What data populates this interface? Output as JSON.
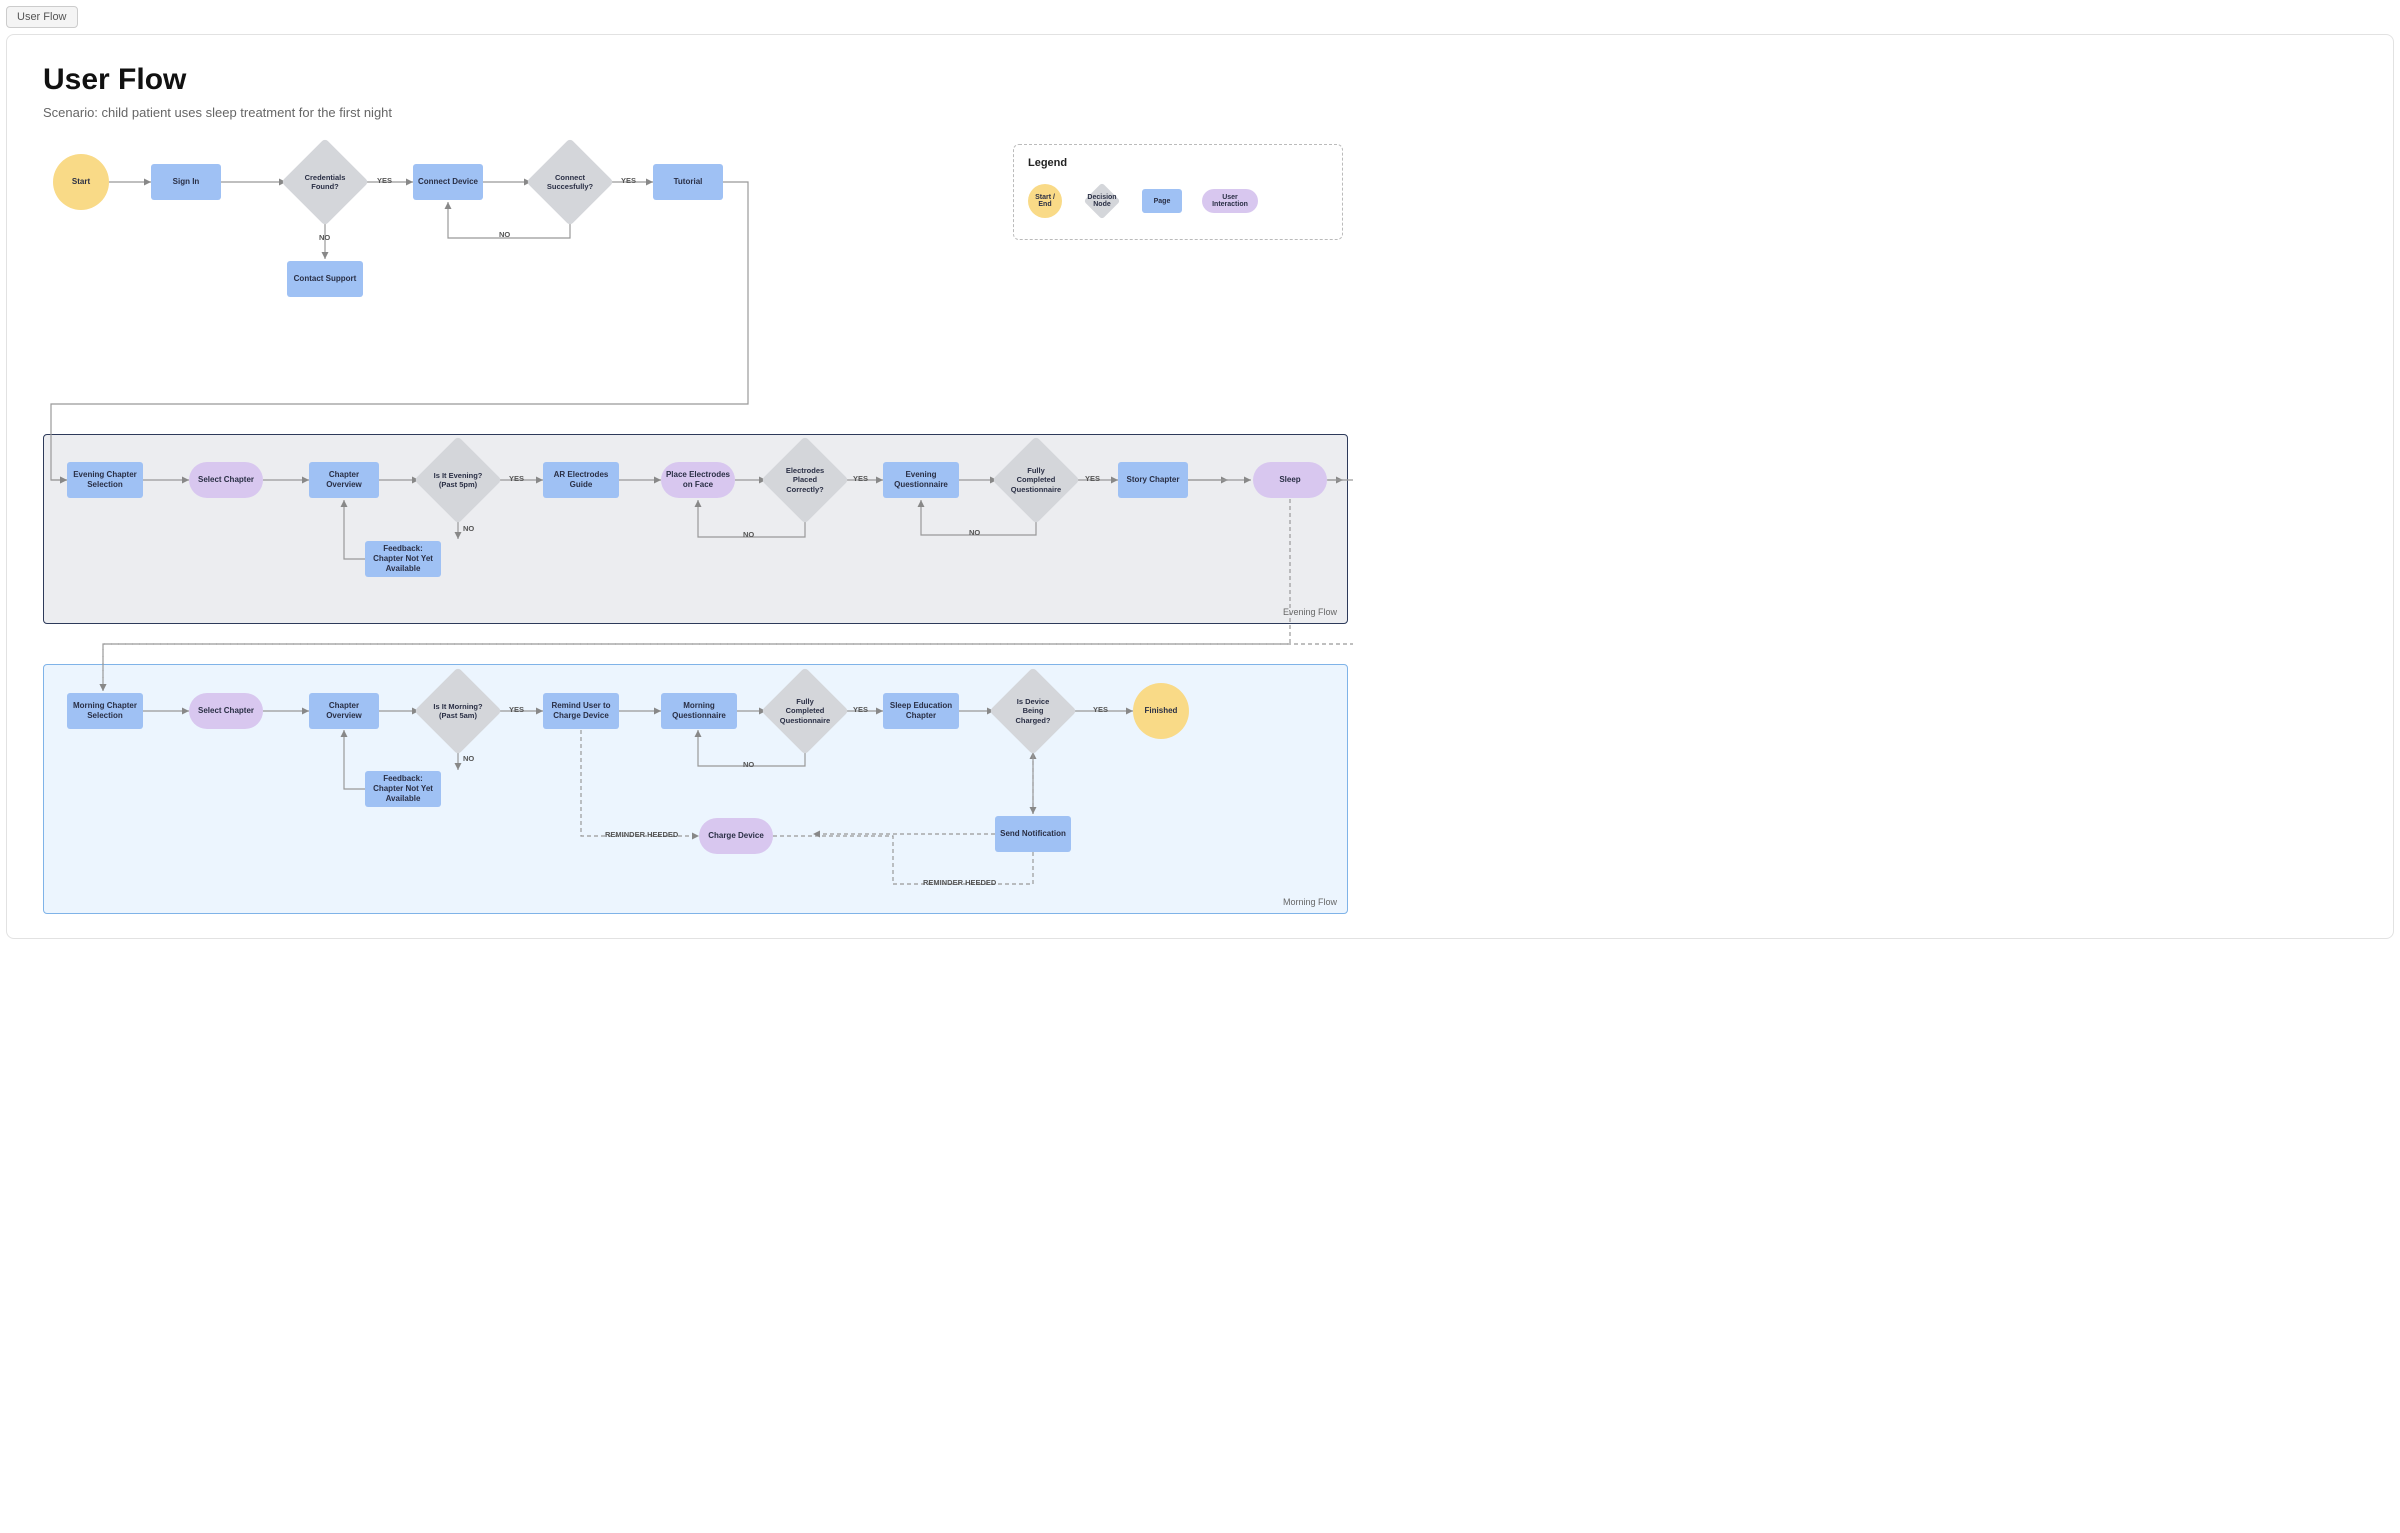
{
  "tab": "User Flow",
  "title": "User Flow",
  "subtitle": "Scenario: child patient uses sleep treatment for the first night",
  "legend": {
    "title": "Legend",
    "startEnd": "Start / End",
    "decision": "Decision Node",
    "page": "Page",
    "interaction": "User Interaction"
  },
  "labels": {
    "yes": "YES",
    "no": "NO",
    "reminderHeeded": "REMINDER HEEDED"
  },
  "zones": {
    "evening": "Evening Flow",
    "morning": "Morning Flow"
  },
  "nodes": {
    "start": "Start",
    "signIn": "Sign In",
    "credentialsFound": "Credentials Found?",
    "connectDevice": "Connect Device",
    "connectSuccess": "Connect Succesfully?",
    "tutorial": "Tutorial",
    "contactSupport": "Contact Support",
    "eveningChapterSelection": "Evening Chapter Selection",
    "selectChapter1": "Select Chapter",
    "chapterOverview1": "Chapter Overview",
    "isItEvening": "Is It Evening? (Past 5pm)",
    "feedbackEvening": "Feedback: Chapter Not Yet Available",
    "arElectrodesGuide": "AR Electrodes Guide",
    "placeElectrodes": "Place Electrodes on Face",
    "electrodesCorrect": "Electrodes Placed Correctly?",
    "eveningQuestionnaire": "Evening Questionnaire",
    "fullyCompleted1": "Fully Completed Questionnaire",
    "storyChapter": "Story Chapter",
    "sleep": "Sleep",
    "morningChapterSelection": "Morning Chapter Selection",
    "selectChapter2": "Select Chapter",
    "chapterOverview2": "Chapter Overview",
    "isItMorning": "Is It Morning? (Past 5am)",
    "feedbackMorning": "Feedback: Chapter Not Yet Available",
    "remindCharge": "Remind User to Charge Device",
    "morningQuestionnaire": "Morning Questionnaire",
    "fullyCompleted2": "Fully Completed Questionnaire",
    "sleepEducation": "Sleep Education Chapter",
    "isDeviceCharged": "Is Device Being Charged?",
    "sendNotification": "Send Notification",
    "chargeDevice": "Charge Device",
    "finished": "Finished"
  }
}
